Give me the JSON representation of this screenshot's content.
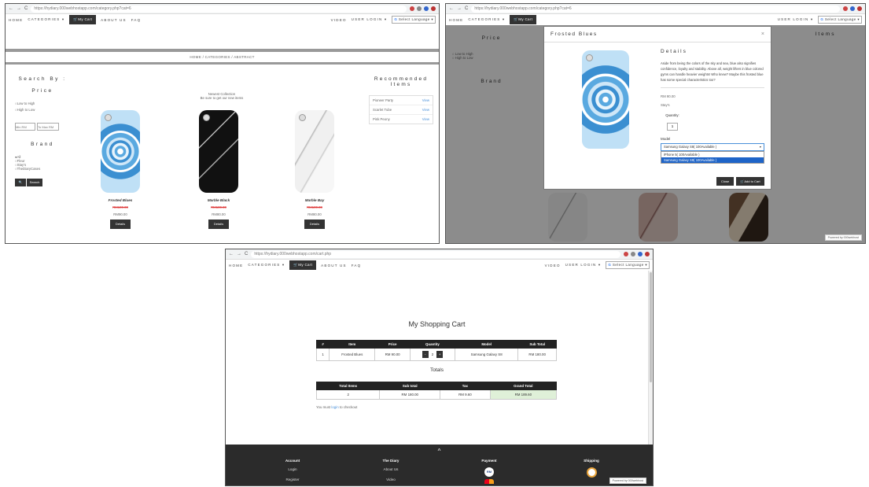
{
  "browser": {
    "url1": "https://hydiary.000webhostapp.com/category.php?cat=6",
    "url2": "https://hydiary.000webhostapp.com/category.php?cat=6",
    "url3": "https://hydiary.000webhostapp.com/cart.php"
  },
  "nav": {
    "home": "HOME",
    "categories": "CATEGORIES ▾",
    "cart": "🛒My Cart",
    "about": "ABOUT US",
    "faq": "FAQ",
    "video": "VIDEO",
    "user_login": "USER LOGIN ▾",
    "select_language": "Select Language ▾",
    "google_g": "G"
  },
  "category_page": {
    "breadcrumb": "HOME / CATEGORIES / ABSTRACT",
    "search_by": "Search By :",
    "price_heading": "Price",
    "price_options": [
      "Low to High",
      "High to Low"
    ],
    "min_placeholder": "Min RM",
    "max_placeholder": "To Max RM",
    "brand_heading": "Brand",
    "brand_options": [
      "All",
      "Fleur",
      "Stay's",
      "TheDiaryCases"
    ],
    "search_icon": "🔍",
    "search_button": "Search",
    "newest_title": "Newest Collection",
    "newest_sub": "Be sure to get our new items",
    "products": [
      {
        "name": "Frosted Blues",
        "old_price": "RM100.00",
        "price": "RM90.00",
        "details": "Details"
      },
      {
        "name": "Marble Black",
        "old_price": "RM100.00",
        "price": "RM80.00",
        "details": "Details"
      },
      {
        "name": "Marble Bay",
        "old_price": "RM100.00",
        "price": "RM80.00",
        "details": "Details"
      }
    ],
    "recommended_title": "Recommended Items",
    "recommended": [
      {
        "name": "Pioneer Party",
        "link": "View"
      },
      {
        "name": "Scarlet Tube",
        "link": "View"
      },
      {
        "name": "Pink Peony",
        "link": "View"
      }
    ]
  },
  "modal": {
    "title": "Frosted Blues",
    "close": "×",
    "details_heading": "Details",
    "description": "Aside from being the colors of the sky and sea, blue also signifies confidence, loyalty and stability. Above all, weight lifters in blue colored gyms can handle heavier weights! Who knew? Maybe this frosted blue has some special characteristics too?",
    "price": "RM 90.00",
    "brand": "Stay's",
    "quantity_label": "Quantity:",
    "quantity_value": "1",
    "model_label": "Model",
    "model_selected": "Samsung Galaxy S8( 100Available )",
    "model_options": [
      "iPhone 5( 100Available )",
      "Samsung Galaxy S8( 100Available )"
    ],
    "close_button": "Close",
    "add_button": "🛒Add to Cart",
    "bg_items_heading": "Items",
    "bg_price": "Price",
    "bg_brand": "Brand",
    "powered": "Powered by 000webhost"
  },
  "cart_page": {
    "title": "My Shopping Cart",
    "columns": [
      "#",
      "Item",
      "Price",
      "Quantity",
      "Model",
      "Sub Total"
    ],
    "rows": [
      {
        "num": "1",
        "item": "Frosted Blues",
        "price": "RM 90.00",
        "qty": "2",
        "minus": "-",
        "plus": "+",
        "model": "Samsung Galaxy S8",
        "subtotal": "RM 180.00"
      }
    ],
    "totals_title": "Totals",
    "totals_columns": [
      "Total Items",
      "Sub total",
      "Tax",
      "Grand Total"
    ],
    "totals_row": {
      "items": "2",
      "subtotal": "RM 180.00",
      "tax": "RM 9.60",
      "grand": "RM 189.60"
    },
    "login_prefix": "You must ",
    "login_link": "login",
    "login_suffix": " to checkout",
    "footer_arrow": "^",
    "footer_cols": [
      {
        "heading": "Account",
        "items": [
          "Login",
          "Register"
        ]
      },
      {
        "heading": "The Diary",
        "items": [
          "About Us",
          "Video"
        ]
      },
      {
        "heading": "Payment",
        "items": [
          "RM"
        ]
      },
      {
        "heading": "Shipping",
        "items": []
      }
    ],
    "powered": "Powered by 000webhost"
  },
  "colors": {
    "accent_blue": "#4a90d9",
    "dark": "#333333",
    "grand_total_bg": "#dff0d8"
  }
}
